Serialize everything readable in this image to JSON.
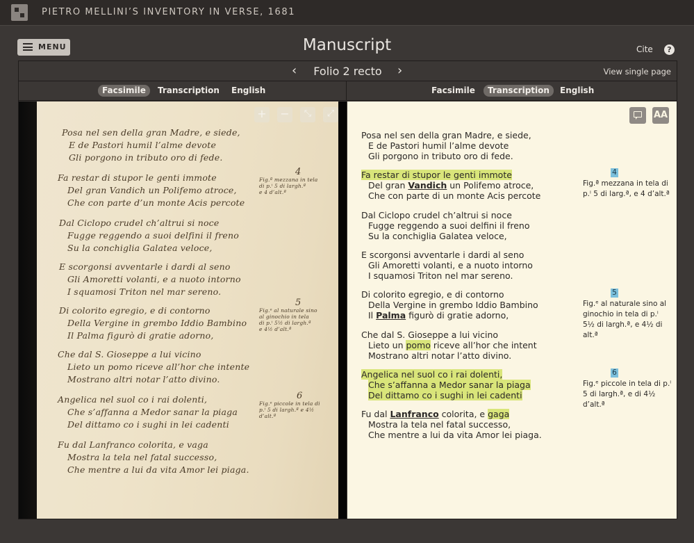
{
  "site": {
    "title": "PIETRO MELLINI’S INVENTORY IN VERSE, 1681",
    "logo": "logo-icon"
  },
  "header": {
    "menu_label": "MENU",
    "page_title": "Manuscript",
    "cite_label": "Cite",
    "help_label": "?"
  },
  "viewer": {
    "folio_label": "Folio 2 recto",
    "prev_icon": "‹",
    "next_icon": "›",
    "view_single_label": "View single page",
    "left_tabs": [
      "Facsimile",
      "Transcription",
      "English"
    ],
    "left_active": "Facsimile",
    "right_tabs": [
      "Facsimile",
      "Transcription",
      "English"
    ],
    "right_active": "Transcription",
    "zoom_controls": [
      "+",
      "−",
      "⤡",
      "⤢"
    ]
  },
  "transcription": {
    "text_size_label": "AA",
    "stanzas": [
      [
        "Posa nel sen della gran Madre, e siede,",
        "E de Pastori humil l’alme devote",
        "Gli porgono in tributo oro di fede."
      ],
      [
        "Fa restar di stupor le genti immote",
        "Del gran ",
        "Vandich",
        " un Polifemo atroce,",
        "Che con parte di un monte Acis percote"
      ],
      [
        "Dal Ciclopo crudel ch’altrui si noce",
        "Fugge reggendo a suoi delfini il freno",
        "Su la conchiglia Galatea veloce,"
      ],
      [
        "E scorgonsi avventarle i dardi al seno",
        "Gli Amoretti volanti, e a nuoto intorno",
        "I squamosi Triton nel mar sereno."
      ],
      [
        "Di colorito egregio, e di contorno",
        "Della Vergine in grembo Iddio Bambino",
        "Il ",
        "Palma",
        " figurò di gratie adorno,"
      ],
      [
        "Che dal S. Gioseppe a lui vicino",
        "Lieto un ",
        "pomo",
        " riceve all’hor che intent",
        "Mostrano altri notar l’atto divino."
      ],
      [
        "Angelica nel suol co i rai dolenti,",
        "Che s’affanna a Medor sanar la piaga",
        "Del dittamo co i sughi in lei cadenti"
      ],
      [
        "Fu dal ",
        "Lanfranco",
        " colorita, e ",
        "gaga",
        "Mostra la tela nel fatal successo,",
        "Che mentre a lui da vita Amor lei piaga."
      ]
    ],
    "notes": [
      {
        "num": "4",
        "lines": [
          "Fig.ª mezzana in tela di",
          "p.ⁱ 5 di larg.ª, e 4 d’alt.ª"
        ]
      },
      {
        "num": "5",
        "lines": [
          "Fig.ᵉ al naturale sino al",
          "ginochio in tela di p.ⁱ",
          "5½ di largh.ª, e 4½ di",
          "alt.ª"
        ]
      },
      {
        "num": "6",
        "lines": [
          "Fig.ᵉ piccole in tela di p.ⁱ",
          "5 di largh.ª, e di 4½",
          "d’alt.ª"
        ]
      }
    ]
  },
  "facsimile": {
    "lines": [
      "Posa nel sen della gran Madre, e siede,",
      "E de Pastori humil l’alme devote",
      "Gli porgono in tributo oro di fede.",
      "Fa restar di stupor le genti immote",
      "Del gran Vandich un Polifemo atroce,",
      "Che con parte d’un monte Acis percote",
      "Dal Ciclopo crudel ch’altrui si noce",
      "Fugge reggendo a suoi delfini il freno",
      "Su la conchiglia Galatea veloce,",
      "E scorgonsi avventarle i dardi al seno",
      "Gli Amoretti volanti, e a nuoto intorno",
      "I squamosi Triton nel mar sereno.",
      "Di colorito egregio, e di contorno",
      "Della Vergine in grembo Iddio Bambino",
      "Il Palma figurò di gratie adorno,",
      "Che dal S. Gioseppe a lui vicino",
      "Lieto un pomo riceve all’hor che intente",
      "Mostrano altri notar l’atto divino.",
      "Angelica nel suol co i rai dolenti,",
      "Che s’affanna a Medor sanar la piaga",
      "Del dittamo co i sughi in lei cadenti",
      "Fu dal Lanfranco colorita, e vaga",
      "Mostra la tela nel fatal successo,",
      "Che mentre a lui da vita Amor lei piaga."
    ],
    "margin_nums": [
      "4",
      "5",
      "6"
    ],
    "margin_notes": [
      "Fig.ª mezzana in tela\ndi p.ⁱ 5 di largh.ª\ne 4 d’alt.ª",
      "Fig.ᵉ al naturale sino\nal ginochio in tela\ndi p.ⁱ 5½ di largh.ª\ne 4½ d’alt.ª",
      "Fig.ᵉ piccole in tela di\np.ⁱ 5 di largh.ª e 4½\nd’alt.ª"
    ]
  },
  "colors": {
    "highlight": "#d9e57a",
    "note_badge": "#7cc0dc",
    "pane_bg": "#fbf6e3"
  }
}
